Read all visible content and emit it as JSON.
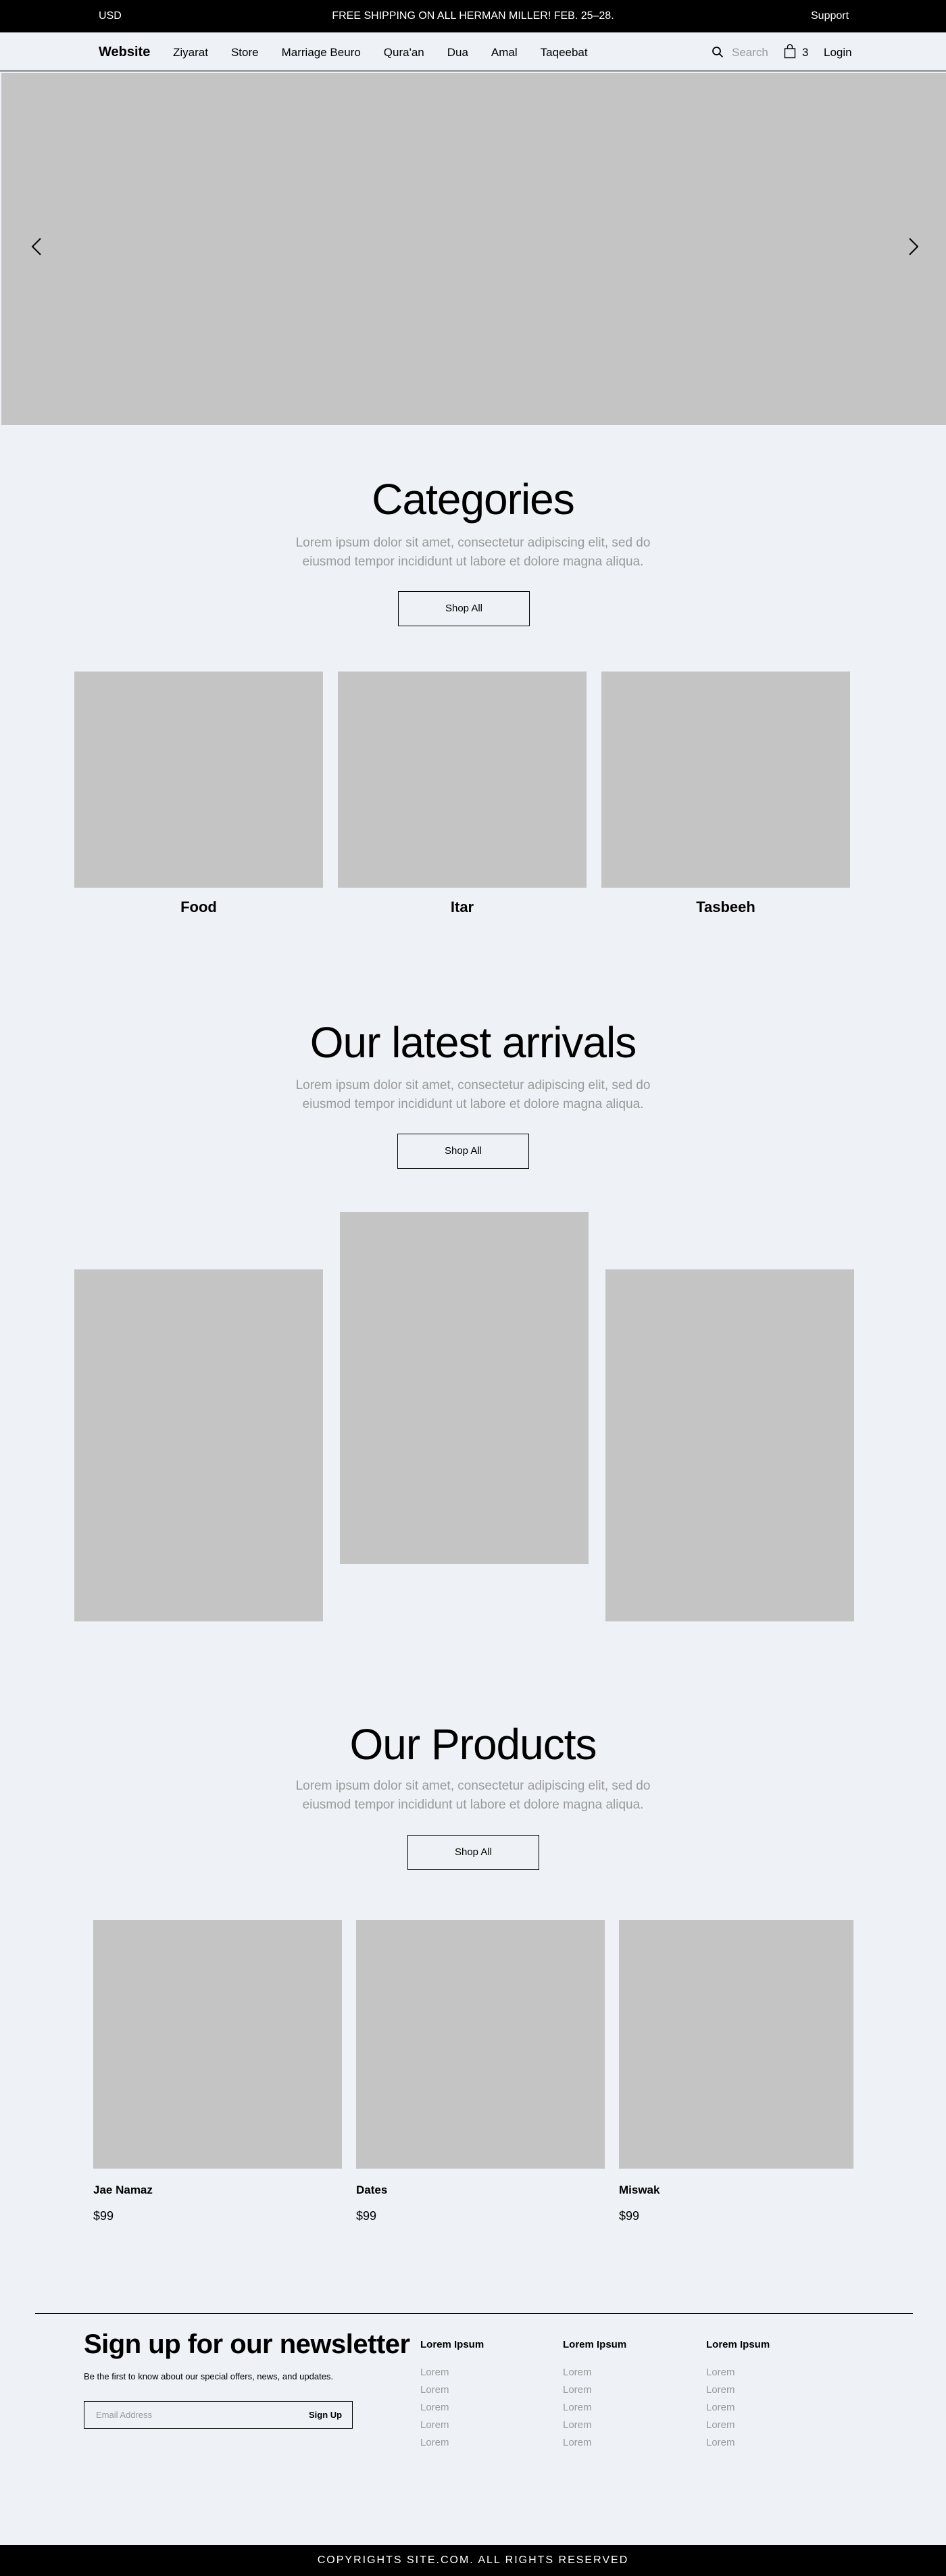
{
  "topbar": {
    "currency": "USD",
    "promo": "FREE SHIPPING ON ALL HERMAN MILLER! FEB. 25–28.",
    "support": "Support"
  },
  "nav": {
    "brand": "Website",
    "items": [
      "Ziyarat",
      "Store",
      "Marriage Beuro",
      "Qura'an",
      "Dua",
      "Amal",
      "Taqeebat"
    ],
    "search_placeholder": "Search",
    "cart_count": "3",
    "login": "Login"
  },
  "categories": {
    "title": "Categories",
    "description": "Lorem ipsum dolor sit amet, consectetur adipiscing elit, sed do eiusmod tempor incididunt ut labore et dolore magna aliqua.",
    "button": "Shop All",
    "items": [
      {
        "label": "Food"
      },
      {
        "label": "Itar"
      },
      {
        "label": "Tasbeeh"
      }
    ]
  },
  "arrivals": {
    "title": "Our latest arrivals",
    "description": "Lorem ipsum dolor sit amet, consectetur adipiscing elit, sed do eiusmod tempor incididunt ut labore et dolore magna aliqua.",
    "button": "Shop All"
  },
  "products": {
    "title": "Our Products",
    "description": "Lorem ipsum dolor sit amet, consectetur adipiscing elit, sed do eiusmod tempor incididunt ut labore et dolore magna aliqua.",
    "button": "Shop All",
    "items": [
      {
        "name": "Jae Namaz",
        "price": "$99"
      },
      {
        "name": "Dates",
        "price": "$99"
      },
      {
        "name": "Miswak",
        "price": "$99"
      }
    ]
  },
  "newsletter": {
    "title": "Sign up for our newsletter",
    "subtitle": "Be the first to know about our special offers, news, and updates.",
    "email_placeholder": "Email Address",
    "signup": "Sign Up"
  },
  "footer_columns": [
    {
      "heading": "Lorem Ipsum",
      "links": [
        "Lorem",
        "Lorem",
        "Lorem",
        "Lorem",
        "Lorem"
      ]
    },
    {
      "heading": "Lorem Ipsum",
      "links": [
        "Lorem",
        "Lorem",
        "Lorem",
        "Lorem",
        "Lorem"
      ]
    },
    {
      "heading": "Lorem Ipsum",
      "links": [
        "Lorem",
        "Lorem",
        "Lorem",
        "Lorem",
        "Lorem"
      ]
    }
  ],
  "copyright": "COPYRIGHTS SITE.COM. ALL RIGHTS RESERVED"
}
